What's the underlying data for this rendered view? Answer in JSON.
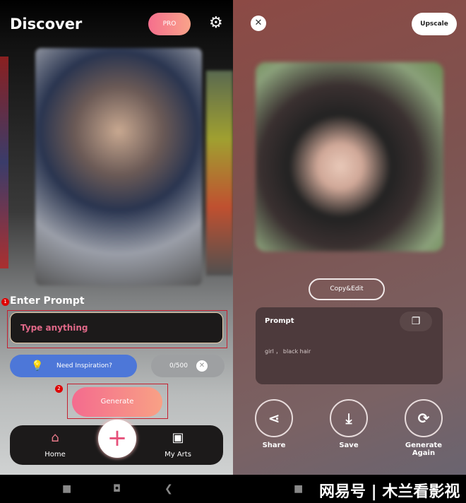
{
  "left": {
    "title": "Discover",
    "pro_label": "PRO",
    "settings_icon": "gear-icon",
    "enter_prompt": "Enter Prompt",
    "step1": "1",
    "step2": "2",
    "input_placeholder": "Type anything",
    "inspiration": "Need Inspiration?",
    "char_count": "0/500",
    "generate": "Generate",
    "tabs": [
      {
        "label": "Home",
        "icon": "home-icon"
      },
      {
        "label": "My Arts",
        "icon": "folder-camera-icon"
      }
    ],
    "accent": "#f46b8e"
  },
  "right": {
    "upscale": "Upscale",
    "copy_edit": "Copy&Edit",
    "prompt_title": "Prompt",
    "prompt_value": "girl ， black hair",
    "actions": [
      {
        "label": "Share",
        "icon": "share-icon"
      },
      {
        "label": "Save",
        "icon": "download-icon"
      },
      {
        "label": "Generate Again",
        "icon": "refresh-icon"
      }
    ]
  },
  "watermark": "网易号 | 木兰看影视"
}
